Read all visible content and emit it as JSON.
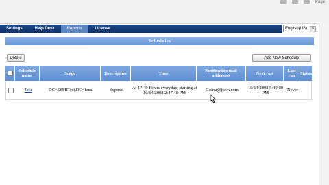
{
  "top": {
    "page_label": "Page"
  },
  "nav": {
    "tabs": [
      {
        "label": "Settings",
        "active": false
      },
      {
        "label": "Help Desk",
        "active": false
      },
      {
        "label": "Reports",
        "active": true
      },
      {
        "label": "License",
        "active": false
      }
    ]
  },
  "language": {
    "selected": "English(US)"
  },
  "panel": {
    "title": "Schedules"
  },
  "toolbar": {
    "delete_label": "Delete",
    "add_label": "Add New Schedule"
  },
  "table": {
    "headers": {
      "name": "Schedule name",
      "scope": "Scope",
      "description": "Description",
      "time": "Time",
      "notification": "Notification mail addresses",
      "next_run": "Next run",
      "last_run": "Last run",
      "status": "Status"
    },
    "rows": [
      {
        "name": "Test",
        "scope": "DC=SSPRTest,DC=local",
        "description": "Expired",
        "time": "At 17:49 Hours everyday, starting at 10/14/2008 2:47:48 PM",
        "notification": "Golnu@jtech.com",
        "next_run": "10/14/2008 5:49:00 PM",
        "last_run": "Never",
        "status": ""
      }
    ]
  },
  "colors": {
    "nav_bg": "#0f2f66",
    "nav_active": "#5b86c4",
    "panel_header": "#6a97d6",
    "table_header": "#5f8fd2",
    "link": "#1a3fb0"
  }
}
